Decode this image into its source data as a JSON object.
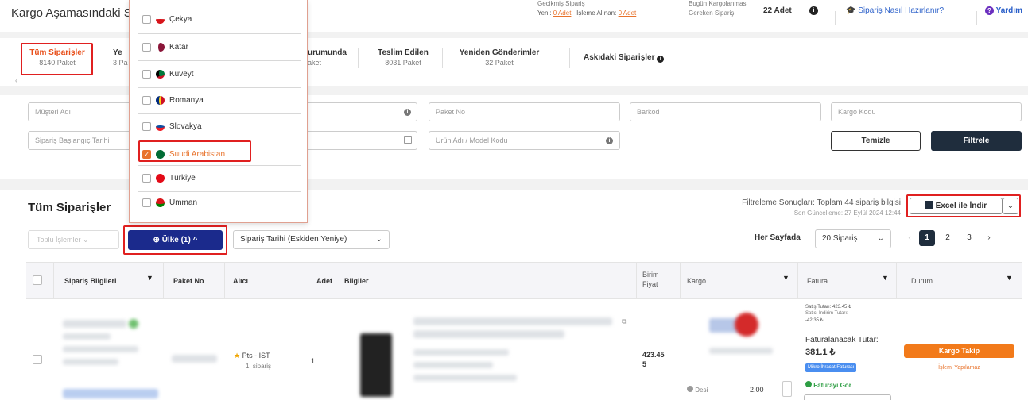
{
  "header": {
    "title": "Kargo Aşamasındaki Siparişler",
    "gecikmis_label": "Gecikmiş Sipariş",
    "yeni_label": "Yeni:",
    "yeni_link": "0 Adet",
    "isleme_label": "İşleme Alınan:",
    "isleme_link": "0 Adet",
    "bugun_label": "Bugün Kargolanması",
    "gereken_label": "Gereken Sipariş",
    "bugun_count": "22 Adet",
    "help_link": "Sipariş Nasıl Hazırlanır?",
    "yardim": "Yardım"
  },
  "tabs": [
    {
      "label": "Tüm Siparişler",
      "sub": "8140 Paket"
    },
    {
      "label": "Ye",
      "sub": "3 Pa"
    },
    {
      "label": "urumunda",
      "sub": "aket"
    },
    {
      "label": "Teslim Edilen",
      "sub": "8031 Paket"
    },
    {
      "label": "Yeniden Gönderimler",
      "sub": "32 Paket"
    },
    {
      "label": "Askıdaki Siparişler",
      "sub": ""
    }
  ],
  "filters": {
    "musteri": "Müşteri Adı",
    "paket_no": "Paket No",
    "barkod": "Barkod",
    "kargo_kodu": "Kargo Kodu",
    "baslangic": "Sipariş Başlangıç Tarihi",
    "urun_adi": "Ürün Adı / Model Kodu",
    "temizle": "Temizle",
    "filtrele": "Filtrele"
  },
  "dropdown": {
    "items": [
      {
        "label": "Çekya",
        "flag_color": "#d7141a",
        "checked": false
      },
      {
        "label": "Katar",
        "flag_color": "#8a1538",
        "checked": false
      },
      {
        "label": "Kuveyt",
        "flag_color": "#007a3d",
        "checked": false
      },
      {
        "label": "Romanya",
        "flag_color": "#fcd116",
        "checked": false
      },
      {
        "label": "Slovakya",
        "flag_color": "#0b4ea2",
        "checked": false
      },
      {
        "label": "Suudi Arabistan",
        "flag_color": "#006c35",
        "checked": true
      },
      {
        "label": "Türkiye",
        "flag_color": "#e30a17",
        "checked": false
      },
      {
        "label": "Umman",
        "flag_color": "#db161b",
        "checked": false
      }
    ]
  },
  "list": {
    "title": "Tüm Siparişler",
    "toplu": "Toplu İşlemler",
    "ulke_btn": "Ülke (1)",
    "sort_select": "Sipariş Tarihi (Eskiden Yeniye)",
    "results_text": "Filtreleme Sonuçları: Toplam 44 sipariş bilgisi",
    "updated_text": "Son Güncelleme: 27 Eylül 2024 12:44",
    "excel": "Excel ile İndir",
    "her_sayfada": "Her Sayfada",
    "per_page": "20 Sipariş",
    "pages": [
      "1",
      "2",
      "3"
    ]
  },
  "table": {
    "headers": {
      "siparis": "Sipariş Bilgileri",
      "paket": "Paket No",
      "alici": "Alıcı",
      "adet": "Adet",
      "bilgiler": "Bilgiler",
      "birim": "Birim",
      "fiyat": "Fiyat",
      "kargo": "Kargo",
      "fatura": "Fatura",
      "durum": "Durum"
    },
    "row": {
      "alici_city": "Pts - IST",
      "alici_sub": "1. sipariş",
      "adet": "1",
      "birim_fiyat": "423.45",
      "birim_fiyat_2": "5",
      "desi_label": "Desi",
      "desi_value": "2.00",
      "satis_tutari": "Satış Tutarı: 423.45 ₺",
      "satis_indirim": "Satıcı İndirim Tutarı:",
      "indirim_value": "-42.35 ₺",
      "faturalanacak": "Faturalanacak Tutar:",
      "faturalanacak_value": "381.1 ₺",
      "mikro": "Mikro İhracat Faturası",
      "faturayi_gor": "Faturayı Gör",
      "kargo_takip": "Kargo Takip",
      "islem": "İşlemi Yapılamaz"
    }
  }
}
